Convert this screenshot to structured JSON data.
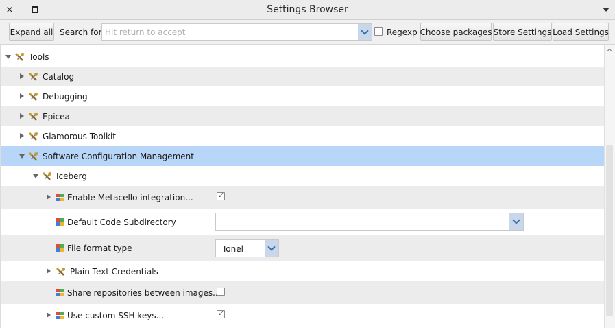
{
  "window": {
    "title": "Settings Browser",
    "close_glyph": "×",
    "minimize_glyph": "–"
  },
  "toolbar": {
    "expand_all_label": "Expand all",
    "search_label": "Search for:",
    "search_placeholder": "Hit return to accept",
    "search_value": "",
    "regexp_label": "Regexp",
    "regexp_checked": false,
    "choose_packages_label": "Choose packages",
    "store_settings_label": "Store Settings",
    "load_settings_label": "Load Settings"
  },
  "tree": {
    "tools": {
      "label": "Tools",
      "expanded": true
    },
    "catalog": {
      "label": "Catalog",
      "expanded": false
    },
    "debugging": {
      "label": "Debugging",
      "expanded": false
    },
    "epicea": {
      "label": "Epicea",
      "expanded": false
    },
    "glamorous_toolkit": {
      "label": "Glamorous Toolkit",
      "expanded": false
    },
    "scm": {
      "label": "Software Configuration Management",
      "expanded": true,
      "selected": true
    },
    "iceberg": {
      "label": "Iceberg",
      "expanded": true
    },
    "enable_metacello": {
      "label": "Enable Metacello integration...",
      "checked": true,
      "expandable": true
    },
    "default_code_subdirectory": {
      "label": "Default Code Subdirectory",
      "value": ""
    },
    "file_format_type": {
      "label": "File format type",
      "value": "Tonel"
    },
    "plain_text_credentials": {
      "label": "Plain Text Credentials",
      "expandable": true
    },
    "share_repositories": {
      "label": "Share repositories between images...",
      "checked": false
    },
    "use_custom_ssh_keys": {
      "label": "Use custom SSH keys...",
      "checked": true,
      "expandable": true
    }
  },
  "colors": {
    "selection": "#b8d6f7",
    "stripe": "#ececec",
    "dropdown_button": "#c9d7ea",
    "tools_icon_gold": "#c8972c",
    "setting_icon": [
      "#d94f3d",
      "#4caf50",
      "#3f7fd6",
      "#f2b233"
    ]
  },
  "icons": {
    "group": "wrench-screwdriver-icon",
    "setting": "setting-grid-icon",
    "checkmark": "✓"
  }
}
